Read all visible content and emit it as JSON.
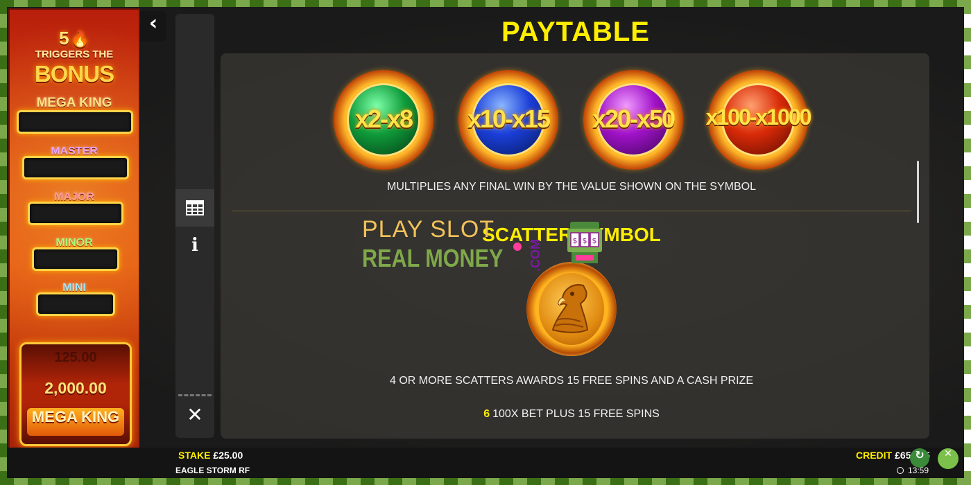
{
  "jackpot_panel": {
    "trigger_count": "5",
    "trigger_text": "TRIGGERS THE",
    "bonus_text": "BONUS",
    "levels": [
      {
        "label": "MEGA KING",
        "value": ""
      },
      {
        "label": "MASTER",
        "value": ""
      },
      {
        "label": "MAJOR",
        "value": ""
      },
      {
        "label": "MINOR",
        "value": ""
      },
      {
        "label": "MINI",
        "value": ""
      }
    ],
    "drum": {
      "ghost_value": "125.00",
      "value": "2,000.00",
      "name": "MEGA KING"
    }
  },
  "nav": {
    "back_icon": "chevron-left-icon",
    "tabs": [
      {
        "icon": "paytable-grid-icon",
        "active": true
      },
      {
        "icon": "info-icon",
        "active": false
      }
    ],
    "close_icon": "close-icon"
  },
  "paytable": {
    "title": "PAYTABLE",
    "multipliers": [
      {
        "value": "x2-x8",
        "color": "green"
      },
      {
        "value": "x10-x15",
        "color": "blue"
      },
      {
        "value": "x20-x50",
        "color": "purple"
      },
      {
        "value": "x100-x1000",
        "color": "red"
      }
    ],
    "multiplier_description": "MULTIPLIES ANY FINAL WIN BY THE VALUE SHOWN ON THE SYMBOL",
    "scatter_title": "SCATTER SYMBOL",
    "scatter_description": "4 OR MORE SCATTERS AWARDS 15 FREE SPINS AND A CASH PRIZE",
    "scatter_payout": {
      "count": "6",
      "text": "100X BET PLUS 15 FREE SPINS"
    }
  },
  "watermark": {
    "line1": "PLAY SLOT",
    "line2": "REAL MONEY",
    "suffix": ".COM"
  },
  "footer": {
    "stake_label": "STAKE",
    "stake_value": "£25.00",
    "game_name": "EAGLE STORM RF",
    "credit_label": "CREDIT",
    "credit_value": "£653.75",
    "clock": "13:59"
  },
  "colors": {
    "accent_yellow": "#ffee00",
    "panel_red": "#d8410f",
    "background": "#1c1c1c"
  }
}
